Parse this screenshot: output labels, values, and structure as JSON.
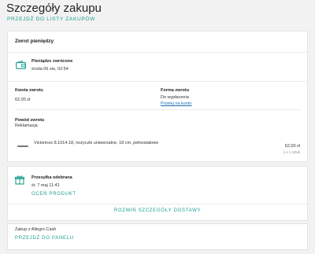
{
  "header": {
    "title": "Szczegóły zakupu",
    "back_link": "PRZEJDŹ DO LISTY ZAKUPÓW"
  },
  "refund": {
    "section_title": "Zwrot pieniędzy",
    "status_icon": "wallet-icon",
    "status_label": "Pieniądze zwrócone",
    "status_date": "środa 06 sie, 02:54",
    "amount_label": "Kwota zwrotu",
    "amount_value": "62,00 zł",
    "method_label": "Forma zwrotu",
    "method_value": "Do wypłacenia",
    "method_link": "Przelej na konto",
    "reason_label": "Powód zwrotu",
    "reason_value": "Reklamacja",
    "item_name": "Victorinox 8.1014.18, nożyczki uniwersalne, 18 cm, pełnostalowe",
    "item_price": "62,00 zł",
    "item_qty": "1 x 1 sztuk"
  },
  "delivery": {
    "status_icon": "gift-icon",
    "status_label": "Przesyłka odebrana",
    "status_date": "śr. 7 maj 11:41",
    "rate_link": "OCEŃ PRODUKT",
    "expand_link": "ROZWIŃ SZCZEGÓŁY DOSTAWY"
  },
  "payment": {
    "label": "Zakup z Allegro Cash",
    "panel_link": "PRZEJDŹ DO PANELU"
  },
  "colors": {
    "accent": "#1b9e8e",
    "link": "#1b6fb5"
  }
}
